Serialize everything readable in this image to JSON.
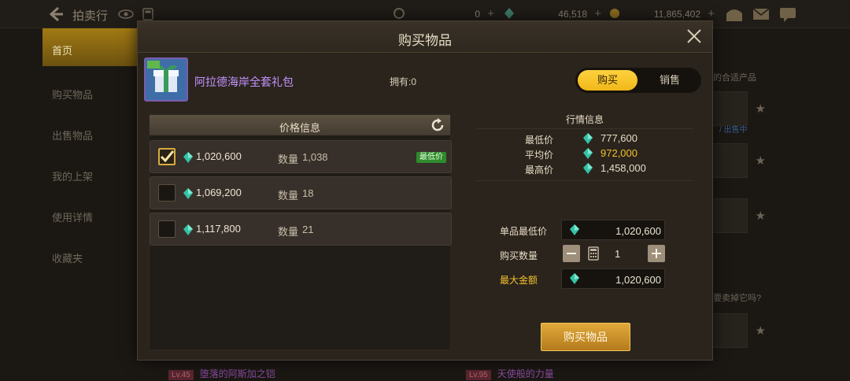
{
  "topbar": {
    "title": "拍卖行",
    "currency1": "0",
    "currency2": "46,518",
    "currency3": "11,865,402"
  },
  "sidebar": {
    "items": [
      {
        "label": "首页"
      },
      {
        "label": "购买物品"
      },
      {
        "label": "出售物品"
      },
      {
        "label": "我的上架"
      },
      {
        "label": "使用详情"
      },
      {
        "label": "收藏夹"
      }
    ]
  },
  "background": {
    "notice1": "的合适产品",
    "status": "/ 出售中",
    "notice2": "要卖掉它吗?",
    "bottom_items": [
      {
        "level": "Lv.45",
        "name": "堕落的阿斯加之铠"
      },
      {
        "level": "Lv.95",
        "name": "天使般的力量"
      }
    ]
  },
  "modal": {
    "title": "购买物品",
    "item_name": "阿拉德海岸全套礼包",
    "owned": "拥有:0",
    "toggle": {
      "buy": "购买",
      "sell": "销售"
    },
    "price_panel_title": "价格信息",
    "qty_label": "数量",
    "lowest_badge": "最低价",
    "listings": [
      {
        "price": "1,020,600",
        "qty": "1,038",
        "checked": true,
        "lowest": true
      },
      {
        "price": "1,069,200",
        "qty": "18",
        "checked": false,
        "lowest": false
      },
      {
        "price": "1,117,800",
        "qty": "21",
        "checked": false,
        "lowest": false
      }
    ],
    "market": {
      "title": "行情信息",
      "min_label": "最低价",
      "min_value": "777,600",
      "avg_label": "平均价",
      "avg_value": "972,000",
      "max_label": "最高价",
      "max_value": "1,458,000"
    },
    "form": {
      "unit_price_label": "单品最低价",
      "unit_price_value": "1,020,600",
      "quantity_label": "购买数量",
      "quantity_value": "1",
      "max_total_label": "最大金额",
      "max_total_value": "1,020,600"
    },
    "buy_button": "购买物品"
  },
  "colors": {
    "accent_gold": "#f4c02c",
    "item_purple": "#c592ff",
    "lowest_green": "#2f8a2c"
  }
}
